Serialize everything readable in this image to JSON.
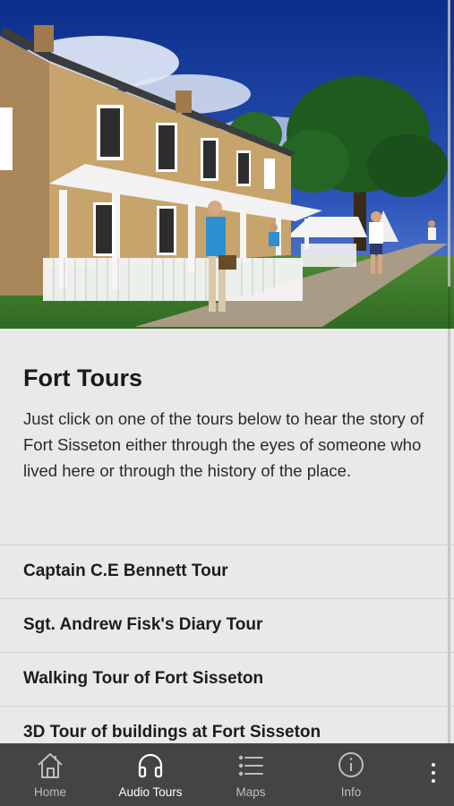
{
  "intro": {
    "title": "Fort Tours",
    "description": "Just click on one of the tours below to hear the story of Fort Sisseton either through the eyes of someone who lived here or through the history of the place."
  },
  "tours": [
    {
      "label": "Captain C.E Bennett Tour"
    },
    {
      "label": "Sgt. Andrew Fisk's Diary Tour"
    },
    {
      "label": "Walking Tour of Fort Sisseton"
    },
    {
      "label": "3D Tour of buildings at Fort Sisseton"
    }
  ],
  "nav": {
    "items": [
      {
        "label": "Home",
        "icon": "home-icon"
      },
      {
        "label": "Audio Tours",
        "icon": "headphones-icon",
        "active": true
      },
      {
        "label": "Maps",
        "icon": "list-icon"
      },
      {
        "label": "Info",
        "icon": "info-icon"
      }
    ],
    "overflow_icon": "more-vertical-icon"
  },
  "colors": {
    "nav_background": "#444444",
    "page_background": "#e9e9e9",
    "active_label": "#ffffff",
    "inactive_label": "#bdbdbd"
  }
}
